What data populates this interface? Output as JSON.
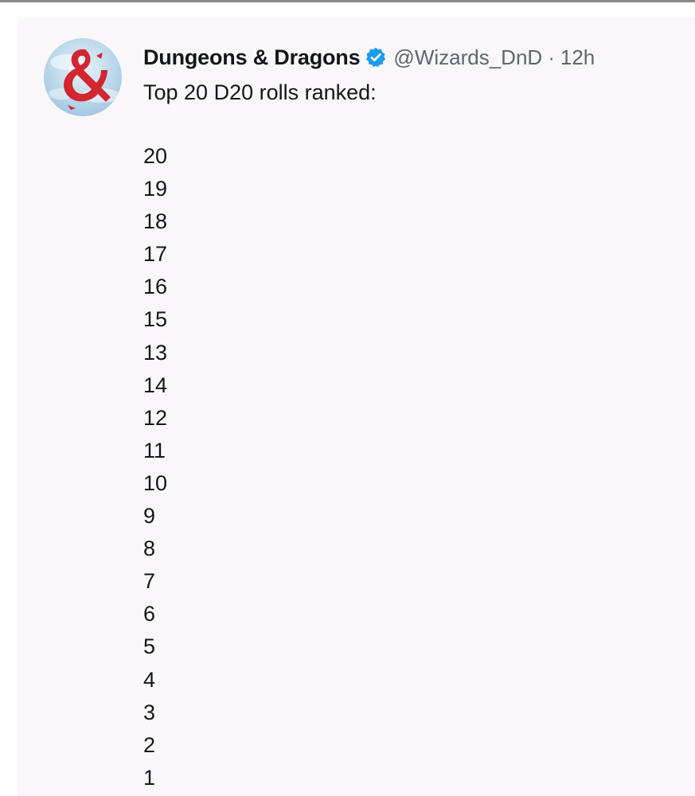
{
  "tweet": {
    "author": {
      "display_name": "Dungeons & Dragons",
      "verified": true,
      "handle": "@Wizards_DnD",
      "separator": "·",
      "time": "12h",
      "avatar_icon": "dnd-ampersand-dragon-icon",
      "avatar_color": "#d22630"
    },
    "text": "Top 20 D20 rolls ranked:",
    "ranking": [
      "20",
      "19",
      "18",
      "17",
      "16",
      "15",
      "13",
      "14",
      "12",
      "11",
      "10",
      "9",
      "8",
      "7",
      "6",
      "5",
      "4",
      "3",
      "2",
      "1"
    ]
  },
  "colors": {
    "verified_badge": "#1d9bf0",
    "text_primary": "#14171a",
    "text_secondary": "#5b6670"
  }
}
